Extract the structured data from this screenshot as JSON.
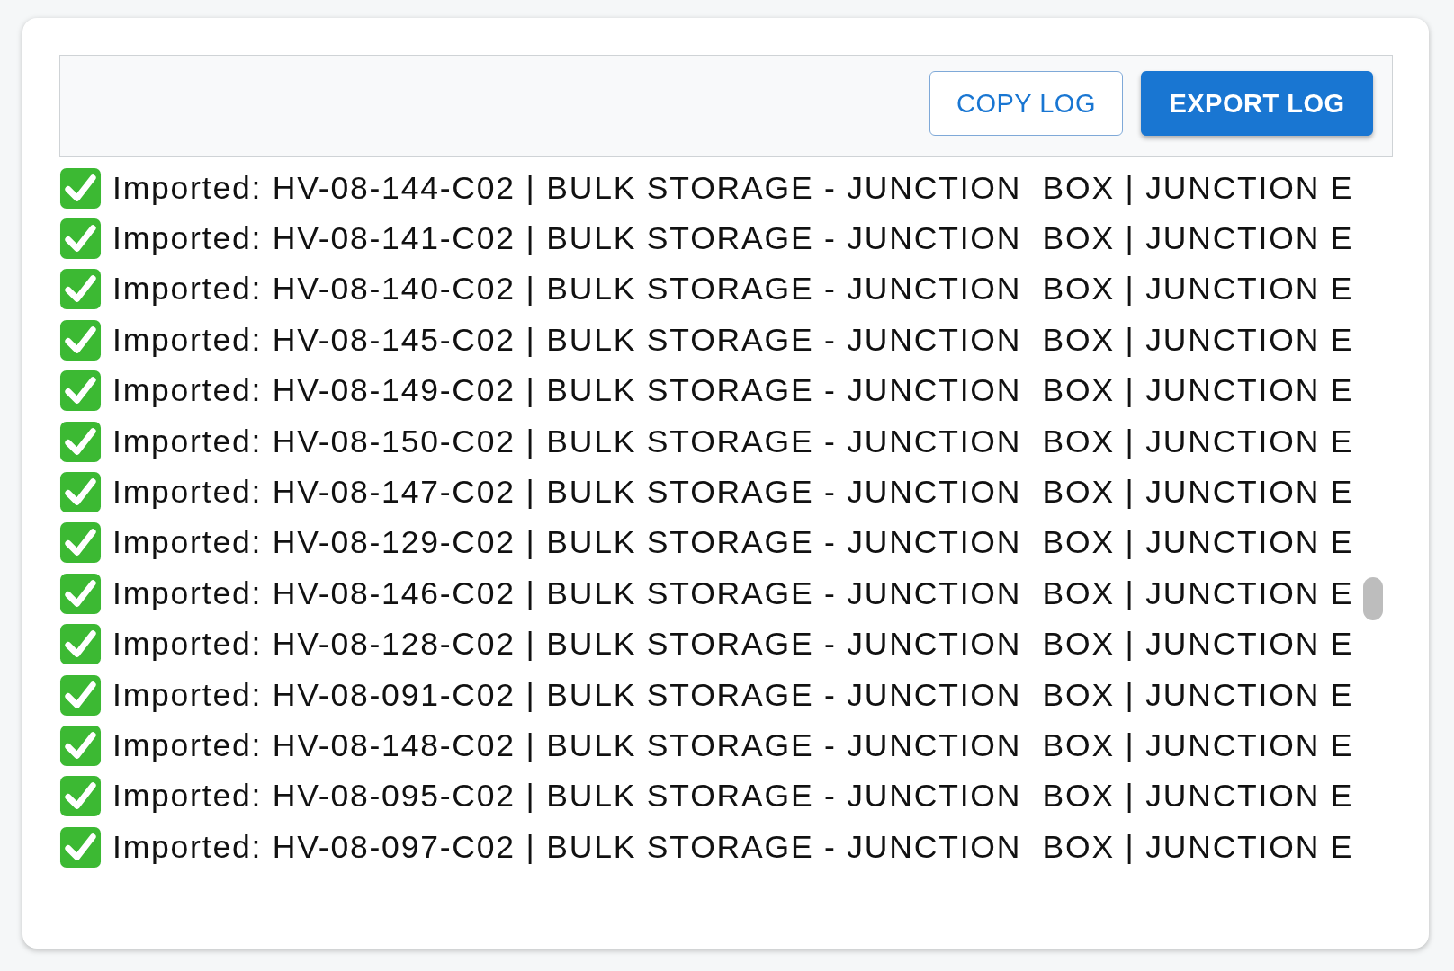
{
  "toolbar": {
    "buttons": [
      {
        "label": "COPY LOG",
        "kind": "outlined"
      },
      {
        "label": "EXPORT LOG",
        "kind": "contained"
      }
    ]
  },
  "log": {
    "entries": [
      {
        "kind": "success",
        "text": "Imported: HV-08-144-C02 | BULK STORAGE - JUNCTION  BOX | JUNCTION E"
      },
      {
        "kind": "success",
        "text": "Imported: HV-08-141-C02 | BULK STORAGE - JUNCTION  BOX | JUNCTION E"
      },
      {
        "kind": "success",
        "text": "Imported: HV-08-140-C02 | BULK STORAGE - JUNCTION  BOX | JUNCTION E"
      },
      {
        "kind": "success",
        "text": "Imported: HV-08-145-C02 | BULK STORAGE - JUNCTION  BOX | JUNCTION E"
      },
      {
        "kind": "success",
        "text": "Imported: HV-08-149-C02 | BULK STORAGE - JUNCTION  BOX | JUNCTION E"
      },
      {
        "kind": "success",
        "text": "Imported: HV-08-150-C02 | BULK STORAGE - JUNCTION  BOX | JUNCTION E"
      },
      {
        "kind": "success",
        "text": "Imported: HV-08-147-C02 | BULK STORAGE - JUNCTION  BOX | JUNCTION E"
      },
      {
        "kind": "success",
        "text": "Imported: HV-08-129-C02 | BULK STORAGE - JUNCTION  BOX | JUNCTION E"
      },
      {
        "kind": "success",
        "text": "Imported: HV-08-146-C02 | BULK STORAGE - JUNCTION  BOX | JUNCTION E"
      },
      {
        "kind": "success",
        "text": "Imported: HV-08-128-C02 | BULK STORAGE - JUNCTION  BOX | JUNCTION E"
      },
      {
        "kind": "success",
        "text": "Imported: HV-08-091-C02 | BULK STORAGE - JUNCTION  BOX | JUNCTION E"
      },
      {
        "kind": "success",
        "text": "Imported: HV-08-148-C02 | BULK STORAGE - JUNCTION  BOX | JUNCTION E"
      },
      {
        "kind": "success",
        "text": "Imported: HV-08-095-C02 | BULK STORAGE - JUNCTION  BOX | JUNCTION E"
      },
      {
        "kind": "success",
        "text": "Imported: HV-08-097-C02 | BULK STORAGE - JUNCTION  BOX | JUNCTION E"
      }
    ]
  }
}
